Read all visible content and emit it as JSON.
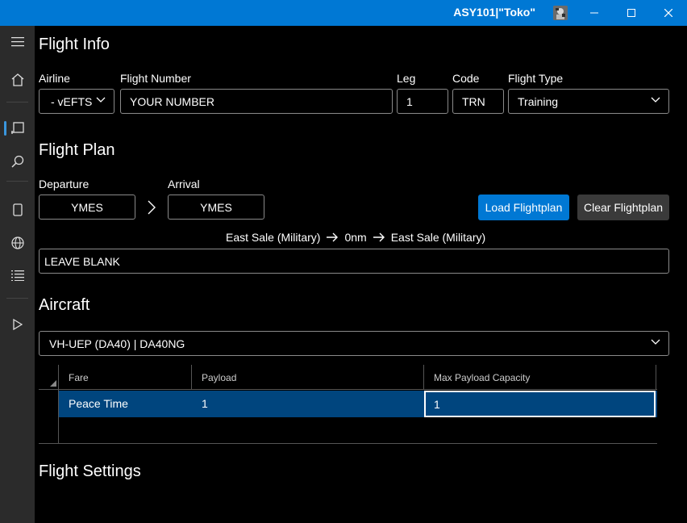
{
  "window": {
    "title": "ASY101|\"Toko\""
  },
  "sidebar": {
    "items": [
      {
        "icon": "hamburger-menu-icon"
      },
      {
        "icon": "home-icon"
      },
      {
        "icon": "flight-plan-icon"
      },
      {
        "icon": "search-icon"
      },
      {
        "icon": "tablet-icon"
      },
      {
        "icon": "globe-icon"
      },
      {
        "icon": "list-icon"
      },
      {
        "icon": "play-icon"
      }
    ]
  },
  "flight_info": {
    "title": "Flight Info",
    "airline_label": "Airline",
    "airline_value": "- vEFTS",
    "flight_number_label": "Flight Number",
    "flight_number_value": "YOUR NUMBER",
    "leg_label": "Leg",
    "leg_value": "1",
    "code_label": "Code",
    "code_value": "TRN",
    "flight_type_label": "Flight Type",
    "flight_type_value": "Training"
  },
  "flight_plan": {
    "title": "Flight Plan",
    "departure_label": "Departure",
    "departure_value": "YMES",
    "arrival_label": "Arrival",
    "arrival_value": "YMES",
    "load_button": "Load Flightplan",
    "clear_button": "Clear Flightplan",
    "route_from": "East Sale (Military)",
    "route_distance": "0nm",
    "route_to": "East Sale (Military)",
    "route_value": "LEAVE BLANK"
  },
  "aircraft": {
    "title": "Aircraft",
    "selected": "VH-UEP (DA40) | DA40NG",
    "table": {
      "columns": [
        "Fare",
        "Payload",
        "Max Payload Capacity"
      ],
      "rows": [
        [
          "Peace Time",
          "1",
          "1"
        ]
      ]
    }
  },
  "flight_settings": {
    "title": "Flight Settings"
  },
  "colors": {
    "accent": "#0078d4",
    "selected_row": "#00457e",
    "sidebar_bg": "#2b2b2b"
  }
}
